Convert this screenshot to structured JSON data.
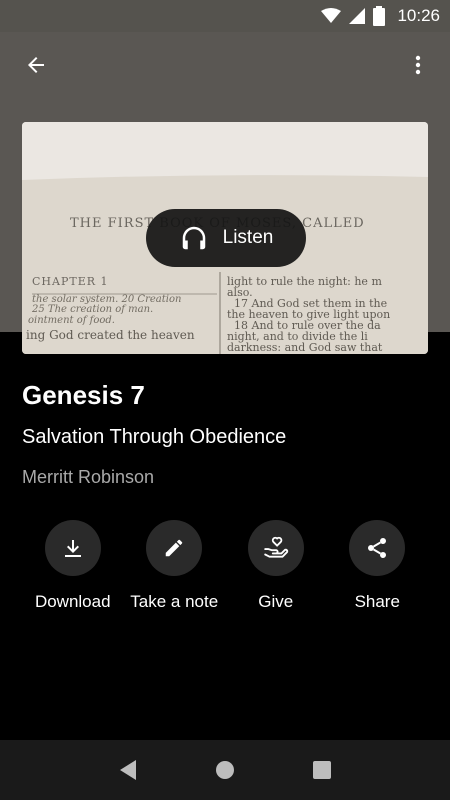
{
  "status_bar": {
    "time": "10:26"
  },
  "hero": {
    "listen_label": "Listen",
    "page_text": {
      "header": "THE FIRST BOOK OF MOSES, CALLED",
      "chapter": "CHAPTER 1",
      "left_lines": [
        "the solar system. 20 Creation",
        "25 The creation of man.",
        "ointment of food.",
        "ing God created the heaven"
      ],
      "right_lines": [
        "light to rule the night: he m",
        "also.",
        "17 And God set them in the",
        "the heaven to give light upon",
        "18 And to rule over the da",
        "night, and to divide the li",
        "darkness: and God saw that"
      ]
    }
  },
  "sermon": {
    "title": "Genesis 7",
    "subtitle": "Salvation Through Obedience",
    "author": "Merritt Robinson"
  },
  "actions": [
    {
      "label": "Download",
      "icon": "download-icon"
    },
    {
      "label": "Take a note",
      "icon": "pencil-icon"
    },
    {
      "label": "Give",
      "icon": "give-heart-hand-icon"
    },
    {
      "label": "Share",
      "icon": "share-icon"
    }
  ],
  "colors": {
    "background": "#000000",
    "header": "#5a5753",
    "action_circle": "#2a2a2a",
    "author": "#a9a9a9"
  }
}
